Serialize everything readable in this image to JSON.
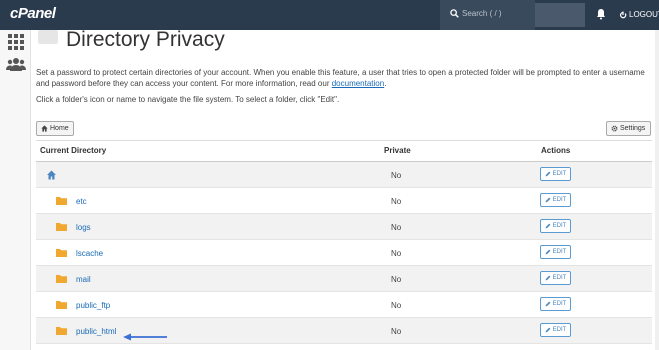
{
  "header": {
    "logo": "cPanel",
    "search_placeholder": "Search ( / )",
    "logout_label": "LOGOUT"
  },
  "page": {
    "title": "Directory Privacy",
    "description_prefix": "Set a password to protect certain directories of your account. When you enable this feature, a user that tries to open a protected folder will be prompted to enter a username and password before they can access your content. For more information, read our ",
    "description_link": "documentation",
    "description_suffix": ".",
    "hint": "Click a folder's icon or name to navigate the file system. To select a folder, click \"Edit\"."
  },
  "toolbar": {
    "home_label": "Home",
    "settings_label": "Settings"
  },
  "table": {
    "headers": {
      "directory": "Current Directory",
      "private": "Private",
      "actions": "Actions"
    },
    "rows": [
      {
        "name": "",
        "private": "No",
        "edit": "EDIT",
        "is_home": true
      },
      {
        "name": "etc",
        "private": "No",
        "edit": "EDIT"
      },
      {
        "name": "logs",
        "private": "No",
        "edit": "EDIT"
      },
      {
        "name": "lscache",
        "private": "No",
        "edit": "EDIT"
      },
      {
        "name": "mail",
        "private": "No",
        "edit": "EDIT"
      },
      {
        "name": "public_ftp",
        "private": "No",
        "edit": "EDIT"
      },
      {
        "name": "public_html",
        "private": "No",
        "edit": "EDIT"
      }
    ]
  },
  "colors": {
    "header_bg": "#2b3b4e",
    "link": "#1a6ab7",
    "folder": "#f0a830",
    "arrow": "#3b6fd4"
  },
  "icons": [
    "search-icon",
    "bell-icon",
    "logout-icon",
    "apps-grid-icon",
    "users-icon",
    "home-icon",
    "gear-icon",
    "folder-icon",
    "pencil-icon",
    "arrow-icon"
  ]
}
